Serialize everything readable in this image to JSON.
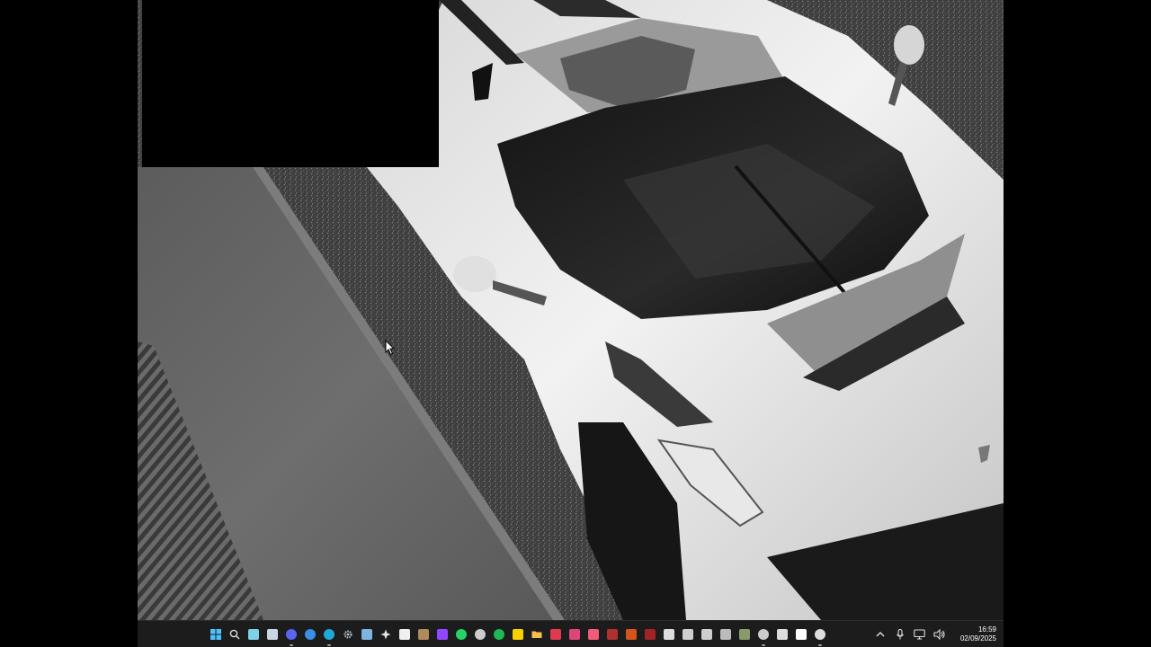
{
  "taskbar": {
    "apps": [
      {
        "name": "start",
        "icon": "windows-logo-icon",
        "color": "#4cc2ff",
        "running": false
      },
      {
        "name": "search",
        "icon": "search-icon",
        "color": "#dddddd",
        "running": false
      },
      {
        "name": "copilot",
        "icon": "copilot-icon",
        "color": "#7fd1e8",
        "running": false
      },
      {
        "name": "steam",
        "icon": "steam-icon",
        "color": "#c9d6e3",
        "running": false
      },
      {
        "name": "discord",
        "icon": "discord-icon",
        "color": "#5865f2",
        "running": true
      },
      {
        "name": "edge-dev",
        "icon": "edge-dev-icon",
        "color": "#3a8ee6",
        "running": false
      },
      {
        "name": "edge",
        "icon": "edge-icon",
        "color": "#1fa9d6",
        "running": true
      },
      {
        "name": "settings",
        "icon": "gear-icon",
        "color": "#b6c2cc",
        "running": false
      },
      {
        "name": "app-window",
        "icon": "window-icon",
        "color": "#7fb3e0",
        "running": false
      },
      {
        "name": "gallery",
        "icon": "cross-icon",
        "color": "#e8e8e8",
        "running": false
      },
      {
        "name": "calendar",
        "icon": "calendar-icon",
        "color": "#f0f0f0",
        "running": false
      },
      {
        "name": "media",
        "icon": "media-icon",
        "color": "#b08a5a",
        "running": false
      },
      {
        "name": "twitch",
        "icon": "twitch-icon",
        "color": "#9146ff",
        "running": false
      },
      {
        "name": "whatsapp",
        "icon": "whatsapp-icon",
        "color": "#25d366",
        "running": false
      },
      {
        "name": "github",
        "icon": "github-icon",
        "color": "#cccccc",
        "running": false
      },
      {
        "name": "spotify",
        "icon": "spotify-icon",
        "color": "#1db954",
        "running": false
      },
      {
        "name": "notes",
        "icon": "note-icon",
        "color": "#f7d000",
        "running": false
      },
      {
        "name": "file-explorer",
        "icon": "folder-icon",
        "color": "#f5c14b",
        "running": false
      },
      {
        "name": "app-red-1",
        "icon": "red-app-icon",
        "color": "#e03a4f",
        "running": false
      },
      {
        "name": "app-red-2",
        "icon": "red-app-icon",
        "color": "#e0457a",
        "running": false
      },
      {
        "name": "music",
        "icon": "music-icon",
        "color": "#f25a7a",
        "running": false
      },
      {
        "name": "app-x",
        "icon": "x-mark-icon",
        "color": "#b03030",
        "running": false
      },
      {
        "name": "app-fox",
        "icon": "fox-icon",
        "color": "#d4541c",
        "running": false
      },
      {
        "name": "app-dark-red",
        "icon": "dark-red-app-icon",
        "color": "#a02424",
        "running": false
      },
      {
        "name": "chart",
        "icon": "stock-chart-icon",
        "color": "#dddddd",
        "running": false
      },
      {
        "name": "document",
        "icon": "document-icon",
        "color": "#cfcfcf",
        "running": false
      },
      {
        "name": "terminal",
        "icon": "terminal-icon",
        "color": "#cfcfcf",
        "running": false
      },
      {
        "name": "layers",
        "icon": "layers-icon",
        "color": "#bbbbbb",
        "running": false
      },
      {
        "name": "app-gear-dark",
        "icon": "dark-app-icon",
        "color": "#8a9a6a",
        "running": false
      },
      {
        "name": "loader",
        "icon": "loader-icon",
        "color": "#cccccc",
        "running": true
      },
      {
        "name": "pen",
        "icon": "pen-icon",
        "color": "#dddddd",
        "running": false
      },
      {
        "name": "tiktok",
        "icon": "tiktok-icon",
        "color": "#ffffff",
        "running": false
      },
      {
        "name": "ai-assistant",
        "icon": "assistant-icon",
        "color": "#dddddd",
        "running": true
      }
    ],
    "tray": {
      "icons": [
        "chevron-up-icon",
        "microphone-icon",
        "network-icon",
        "volume-icon"
      ]
    },
    "clock": {
      "time": "16:59",
      "date": "02/09/2025"
    }
  }
}
